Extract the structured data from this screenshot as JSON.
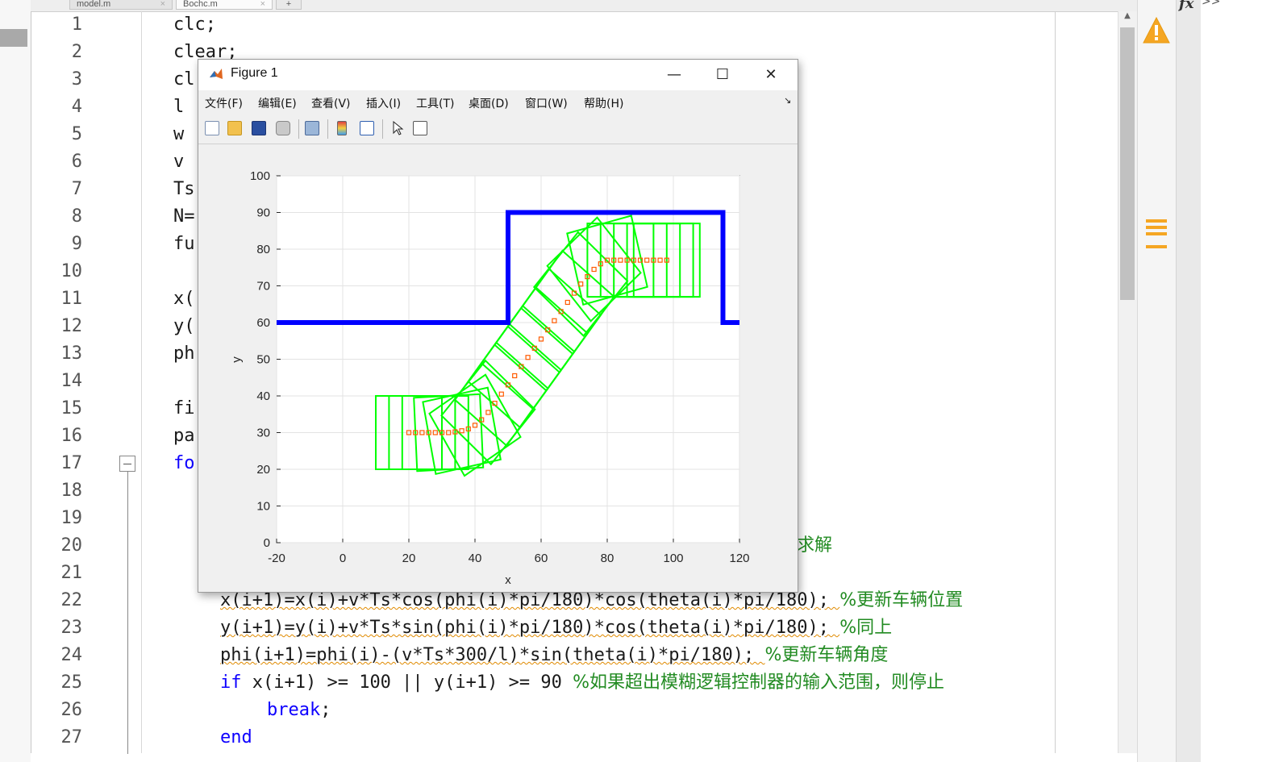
{
  "editor": {
    "tabs": [
      {
        "label": "model.m",
        "close": "×"
      },
      {
        "label": "Bochc.m",
        "close": "×"
      },
      {
        "label": "+"
      }
    ],
    "line_numbers": [
      "1",
      "2",
      "3",
      "4",
      "5",
      "6",
      "7",
      "8",
      "9",
      "10",
      "11",
      "12",
      "13",
      "14",
      "15",
      "16",
      "17",
      "18",
      "19",
      "20",
      "21",
      "22",
      "23",
      "24",
      "25",
      "26",
      "27"
    ],
    "visible_code": {
      "line1": "clc;",
      "line2": "clear;",
      "line3": "cl",
      "line4": "l",
      "line5": "w",
      "line6": "v",
      "line7": "Ts",
      "line8": "N=",
      "line9": "fu",
      "line11": "x(",
      "line12": "y(",
      "line13": "ph",
      "line15": "fi",
      "line16": "pa",
      "line17_kw": "fo",
      "line20_comment_tail": "求解",
      "line22_code": "x(i+1)=x(i)+v*Ts*cos(phi(i)*pi/180)*cos(theta(i)*pi/180); ",
      "line22_comment": "%更新车辆位置",
      "line23_code": "y(i+1)=y(i)+v*Ts*sin(phi(i)*pi/180)*cos(theta(i)*pi/180); ",
      "line23_comment": "%同上",
      "line24_code": "phi(i+1)=phi(i)-(v*Ts*300/l)*sin(theta(i)*pi/180); ",
      "line24_comment": "%更新车辆角度",
      "line25_kw": "if",
      "line25_code": " x(i+1) >= 100 || y(i+1) >= 90 ",
      "line25_comment": "%如果超出模糊逻辑控制器的输入范围，则停止",
      "line26_kw": "break",
      "line26_code": ";",
      "line27_kw": "end"
    }
  },
  "side_panel": {
    "fx": "fx",
    "arrows": ">>",
    "warning_icon": "warning-icon",
    "list_icon": "list-icon"
  },
  "figure": {
    "title": "Figure 1",
    "window_buttons": {
      "minimize": "—",
      "maximize": "☐",
      "close": "✕"
    },
    "menu": [
      "文件(F)",
      "编辑(E)",
      "查看(V)",
      "插入(I)",
      "工具(T)",
      "桌面(D)",
      "窗口(W)",
      "帮助(H)"
    ],
    "menu_arrow": "↘",
    "toolbar_icons": [
      "new-icon",
      "open-icon",
      "save-icon",
      "print-icon",
      "link-icon",
      "colorbar-icon",
      "legend-icon",
      "pointer-icon",
      "propertyeditor-icon"
    ]
  },
  "chart_data": {
    "type": "line",
    "xlabel": "x",
    "ylabel": "y",
    "xlim": [
      -20,
      120
    ],
    "ylim": [
      0,
      100
    ],
    "xticks": [
      -20,
      0,
      20,
      40,
      60,
      80,
      100,
      120
    ],
    "yticks": [
      0,
      10,
      20,
      30,
      40,
      50,
      60,
      70,
      80,
      90,
      100
    ],
    "grid": true,
    "series": [
      {
        "role": "boundary",
        "color": "#0000ff",
        "x": [
          -20,
          50,
          50,
          115,
          115,
          120
        ],
        "y": [
          60,
          60,
          90,
          90,
          60,
          60
        ]
      },
      {
        "role": "trajectory",
        "color": "#ff5a00",
        "x": [
          20,
          22,
          24,
          26,
          28,
          30,
          32,
          34,
          36,
          38,
          40,
          42,
          44,
          46,
          48,
          50,
          52,
          54,
          56,
          58,
          60,
          62,
          64,
          66,
          68,
          70,
          72,
          74,
          76,
          78,
          80,
          82,
          84,
          86,
          88,
          90,
          92,
          94,
          96,
          98
        ],
        "y": [
          30,
          30,
          30,
          30,
          30,
          30,
          30,
          30.2,
          30.5,
          31,
          32,
          33.5,
          35.5,
          38,
          40.5,
          43,
          45.5,
          48,
          50.5,
          53,
          55.5,
          58,
          60.5,
          63,
          65.5,
          68,
          70.5,
          72.5,
          74.5,
          76,
          77,
          77,
          77,
          77,
          77,
          77,
          77,
          77,
          77,
          77
        ]
      }
    ],
    "vehicle_outline": {
      "color": "#00ff00",
      "width": 20,
      "height": 20,
      "sample_step": 2
    }
  }
}
